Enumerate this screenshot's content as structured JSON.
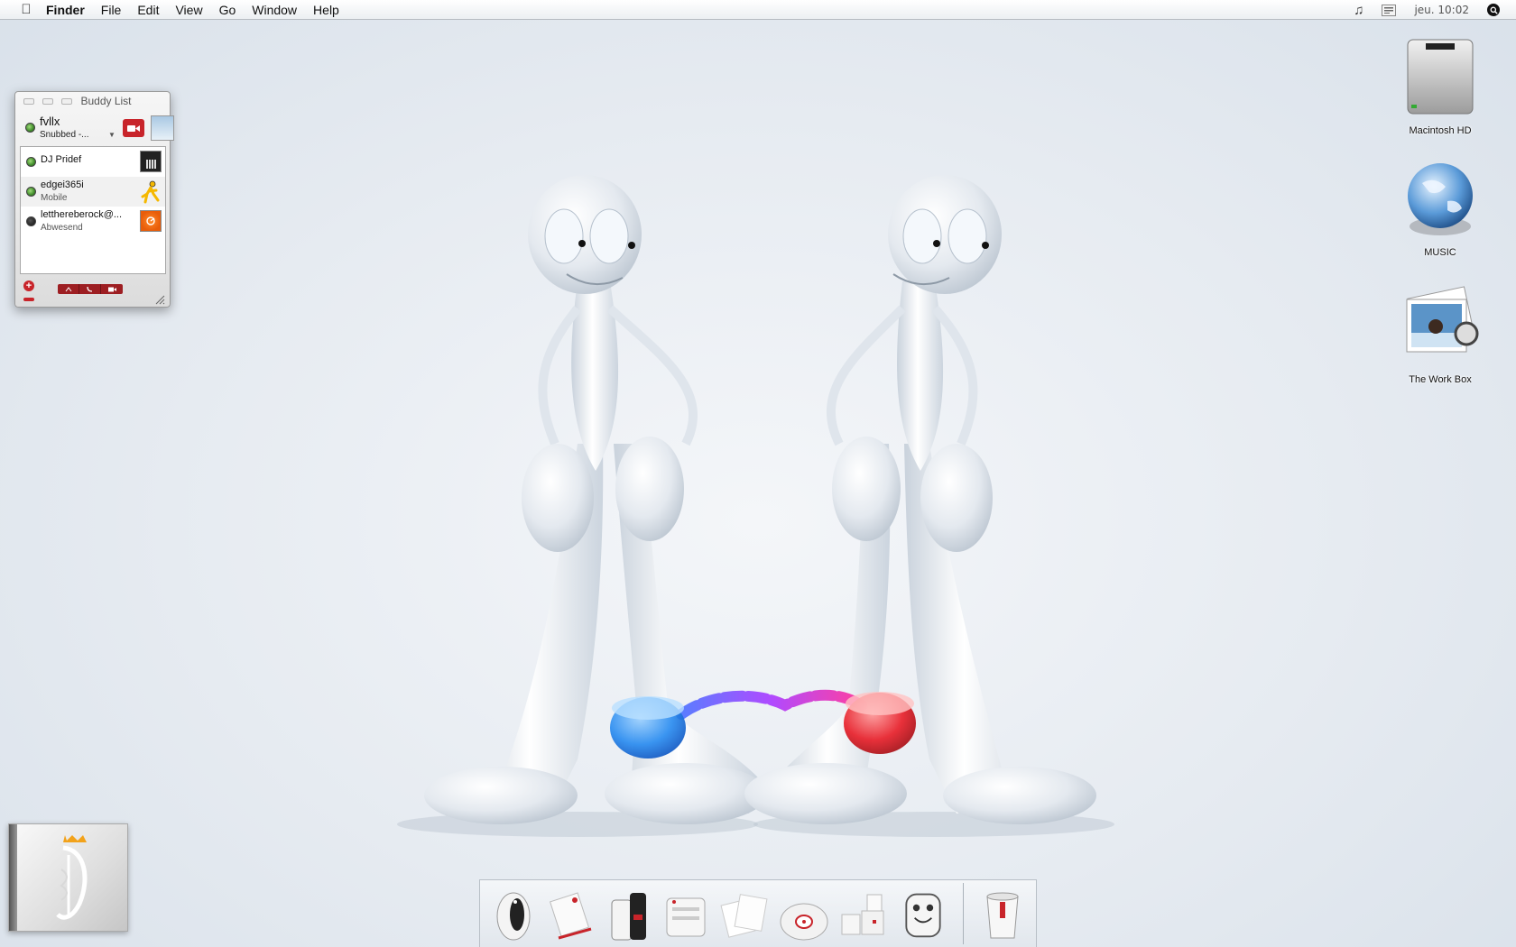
{
  "menubar": {
    "apple_icon": "apple-icon",
    "app_name": "Finder",
    "menus": [
      "File",
      "Edit",
      "View",
      "Go",
      "Window",
      "Help"
    ],
    "clock": "jeu. 10:02",
    "status_icons": [
      "music-note-icon",
      "input-menu-icon",
      "spotlight-icon"
    ]
  },
  "buddy_list": {
    "title": "Buddy List",
    "me": {
      "name": "fvllx",
      "status": "Snubbed -..."
    },
    "buddies": [
      {
        "name": "DJ Pridef",
        "subtitle": "",
        "icon": "piano-icon",
        "status": "online"
      },
      {
        "name": "edgei365i",
        "subtitle": "Mobile",
        "icon": "aim-running-man-icon",
        "status": "online"
      },
      {
        "name": "letthereberock@...",
        "subtitle": "Abwesend",
        "icon": "orange-buddy-icon",
        "status": "away"
      }
    ],
    "toolbar_icons": [
      "add-icon",
      "text-chat-icon",
      "phone-icon",
      "video-icon"
    ]
  },
  "desktop_icons": [
    {
      "label": "Macintosh HD",
      "icon": "hard-drive-icon"
    },
    {
      "label": "MUSIC",
      "icon": "globe-icon"
    },
    {
      "label": "The Work Box",
      "icon": "photos-icon"
    }
  ],
  "dock": {
    "items": [
      "penguin-app-icon",
      "pen-app-icon",
      "coffee-grinder-app-icon",
      "printer-app-icon",
      "papers-app-icon",
      "cd-app-icon",
      "cubes-app-icon",
      "mixer-app-icon",
      "trash-icon"
    ]
  },
  "colors": {
    "accent_red": "#c8242a",
    "cuff_blue": "#2a8cf0",
    "cuff_red": "#e8202a"
  }
}
